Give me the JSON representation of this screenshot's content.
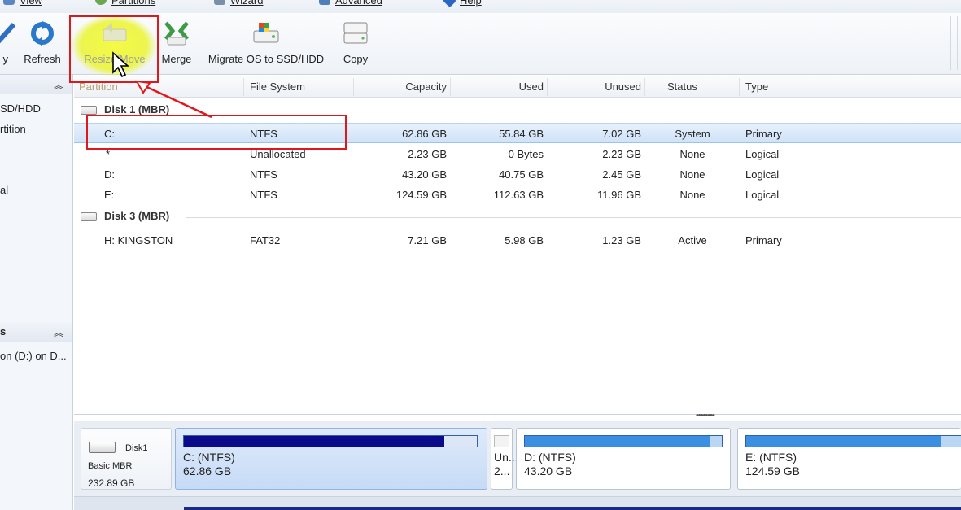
{
  "menu": {
    "items": [
      {
        "label": "View",
        "icon": "view-icon"
      },
      {
        "label": "Partitions",
        "icon": "partitions-icon"
      },
      {
        "label": "Wizard",
        "icon": "wizard-icon"
      },
      {
        "label": "Advanced",
        "icon": "advanced-icon"
      },
      {
        "label": "Help",
        "icon": "help-icon"
      }
    ]
  },
  "toolbar": {
    "apply_label": "y",
    "refresh_label": "Refresh",
    "resize_label": "Resize/Move",
    "merge_label": "Merge",
    "migrate_label": "Migrate OS to SSD/HDD",
    "copy_label": "Copy"
  },
  "left_panel": {
    "items1": [
      "SD/HDD",
      "rtition",
      "al"
    ],
    "section2_title": "s",
    "items2": [
      "on (D:) on D..."
    ]
  },
  "columns": {
    "partition": "Partition",
    "file_system": "File System",
    "capacity": "Capacity",
    "used": "Used",
    "unused": "Unused",
    "status": "Status",
    "type": "Type"
  },
  "disks": [
    {
      "title": "Disk 1 (MBR)",
      "rows": [
        {
          "partition": "C:",
          "fs": "NTFS",
          "capacity": "62.86 GB",
          "used": "55.84 GB",
          "unused": "7.02 GB",
          "status": "System",
          "type": "Primary"
        },
        {
          "partition": "*",
          "fs": "Unallocated",
          "capacity": "2.23 GB",
          "used": "0 Bytes",
          "unused": "2.23 GB",
          "status": "None",
          "type": "Logical"
        },
        {
          "partition": "D:",
          "fs": "NTFS",
          "capacity": "43.20 GB",
          "used": "40.75 GB",
          "unused": "2.45 GB",
          "status": "None",
          "type": "Logical"
        },
        {
          "partition": "E:",
          "fs": "NTFS",
          "capacity": "124.59 GB",
          "used": "112.63 GB",
          "unused": "11.96 GB",
          "status": "None",
          "type": "Logical"
        }
      ]
    },
    {
      "title": "Disk 3 (MBR)",
      "rows": [
        {
          "partition": "H: KINGSTON",
          "fs": "FAT32",
          "capacity": "7.21 GB",
          "used": "5.98 GB",
          "unused": "1.23 GB",
          "status": "Active",
          "type": "Primary"
        }
      ]
    }
  ],
  "diskmap": {
    "disk_name": "Disk1",
    "disk_type": "Basic MBR",
    "disk_size": "232.89 GB",
    "partitions": [
      {
        "name": "C: (NTFS)",
        "size": "62.86 GB",
        "used_fraction": 0.89
      },
      {
        "name": "Un...",
        "size": "2..."
      },
      {
        "name": "D: (NTFS)",
        "size": "43.20 GB",
        "used_fraction": 0.94
      },
      {
        "name": "E: (NTFS)",
        "size": "124.59 GB",
        "used_fraction": 0.9
      }
    ]
  },
  "colors": {
    "accent_red": "#e0181c",
    "used_fill": "#0a0a8a",
    "logical_fill": "#3a8fe0",
    "selection": "#cfe2f8"
  }
}
